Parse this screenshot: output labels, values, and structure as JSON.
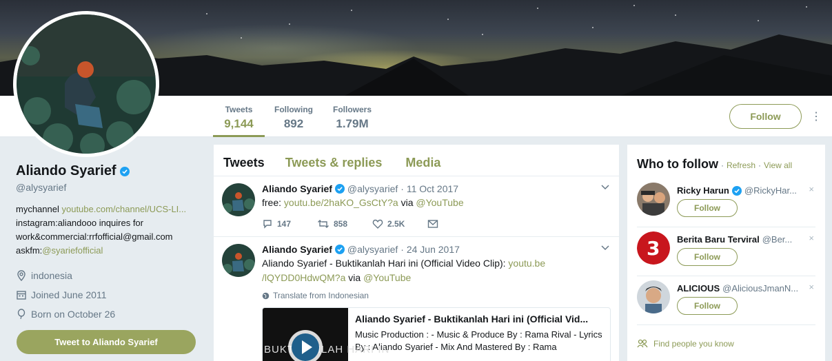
{
  "profile": {
    "name": "Aliando Syarief",
    "handle": "@alysyarief",
    "bio_line1_text": "mychannel ",
    "bio_line1_link": "youtube.com/channel/UCS-LI...",
    "bio_line2": "instagram:aliandooo inquires for",
    "bio_line3": "work&commercial:rrfofficial@gmail.com",
    "bio_line4_text": "askfm:",
    "bio_line4_link": "@syariefofficial",
    "location": "indonesia",
    "joined": "Joined June 2011",
    "born": "Born on October 26",
    "tweet_to_label": "Tweet to Aliando Syarief"
  },
  "nav": {
    "stats": [
      {
        "label": "Tweets",
        "value": "9,144"
      },
      {
        "label": "Following",
        "value": "892"
      },
      {
        "label": "Followers",
        "value": "1.79M"
      }
    ],
    "follow_label": "Follow",
    "more_icon": "⋮"
  },
  "timeline": {
    "tabs": [
      "Tweets",
      "Tweets & replies",
      "Media"
    ],
    "tweets": [
      {
        "name": "Aliando Syarief",
        "handle": "@alysyarief",
        "date": "· 11 Oct 2017",
        "text_prefix": "free: ",
        "link1": "youtu.be/2haKO_GsCtY?a",
        "text_mid": " via ",
        "link2": "@YouTube",
        "replies": "147",
        "retweets": "858",
        "likes": "2.5K"
      },
      {
        "name": "Aliando Syarief",
        "handle": "@alysyarief",
        "date": "· 24 Jun 2017",
        "text_prefix": "Aliando Syarief - Buktikanlah Hari ini (Official Video Clip): ",
        "link1a": "youtu.be",
        "link1b": "/lQYDD0HdwQM?a",
        "text_mid": " via ",
        "link2": "@YouTube",
        "translate": "Translate from Indonesian",
        "card_title": "Aliando Syarief - Buktikanlah Hari ini (Official Vid...",
        "card_desc": "Music Production : - Music & Produce By : Rama Rival - Lyrics By : Aliando Syarief - Mix And Mastered By : Rama",
        "card_thumb_text": "BUKTIKANLAH HARI IN"
      }
    ]
  },
  "who_to_follow": {
    "title": "Who to follow",
    "sep": "·",
    "refresh": "Refresh",
    "view_all": "View all",
    "follow_label": "Follow",
    "close": "×",
    "suggestions": [
      {
        "name": "Ricky Harun",
        "handle": "@RickyHar...",
        "verified": true
      },
      {
        "name": "Berita Baru Terviral",
        "handle": "@Ber...",
        "verified": false
      },
      {
        "name": "ALICIOUS",
        "handle": "@AliciousJmanN...",
        "verified": false
      }
    ],
    "find_people": "Find people you know"
  },
  "colors": {
    "accent": "#8c9a56",
    "verified": "#1da1f2"
  }
}
